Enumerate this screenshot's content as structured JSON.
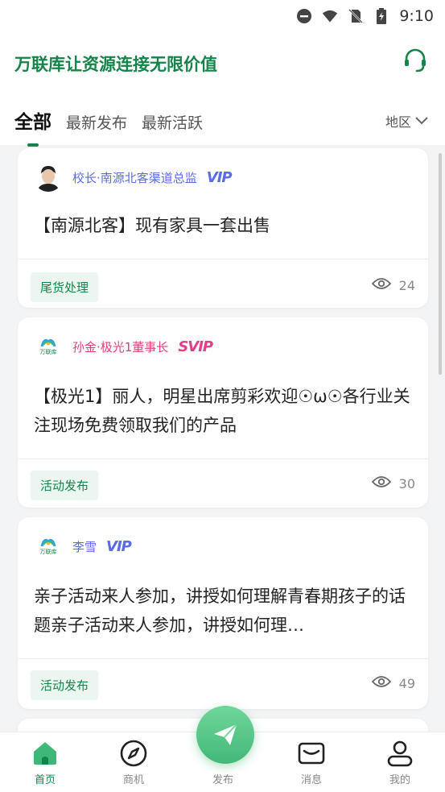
{
  "status_bar": {
    "time": "9:10"
  },
  "header": {
    "title": "万联库让资源连接无限价值",
    "tabs": [
      {
        "label": "全部",
        "active": true
      },
      {
        "label": "最新发布",
        "active": false
      },
      {
        "label": "最新活跃",
        "active": false
      }
    ],
    "region_label": "地区"
  },
  "posts": [
    {
      "author": "校长·南源北客渠道总监",
      "badge": "VIP",
      "badge_color": "#5b6be8",
      "name_color": "#5b6be8",
      "text": "【南源北客】现有家具一套出售",
      "tag": "尾货处理",
      "views": "24"
    },
    {
      "author": "孙金·极光1董事长",
      "badge": "SVIP",
      "badge_color": "#e0408a",
      "name_color": "#e0407a",
      "text": "【极光1】丽人，明星出席剪彩欢迎☉ω☉各行业关注现场免费领取我们的产品",
      "tag": "活动发布",
      "views": "30"
    },
    {
      "author": "李雪",
      "badge": "VIP",
      "badge_color": "#5b6be8",
      "name_color": "#5b6be8",
      "text": "亲子活动来人参加，讲授如何理解青春期孩子的话题亲子活动来人参加，讲授如何理…",
      "tag": "活动发布",
      "views": "49"
    }
  ],
  "avatar_logo_text": "万联库",
  "bottom_nav": {
    "items": [
      {
        "label": "首页",
        "icon": "home-icon",
        "active": true
      },
      {
        "label": "商机",
        "icon": "compass-icon",
        "active": false
      },
      {
        "label": "发布",
        "icon": "send-icon",
        "active": false
      },
      {
        "label": "消息",
        "icon": "mail-icon",
        "active": false
      },
      {
        "label": "我的",
        "icon": "user-icon",
        "active": false
      }
    ]
  },
  "colors": {
    "brand": "#16844a",
    "tag_bg": "#eaf6ef"
  }
}
